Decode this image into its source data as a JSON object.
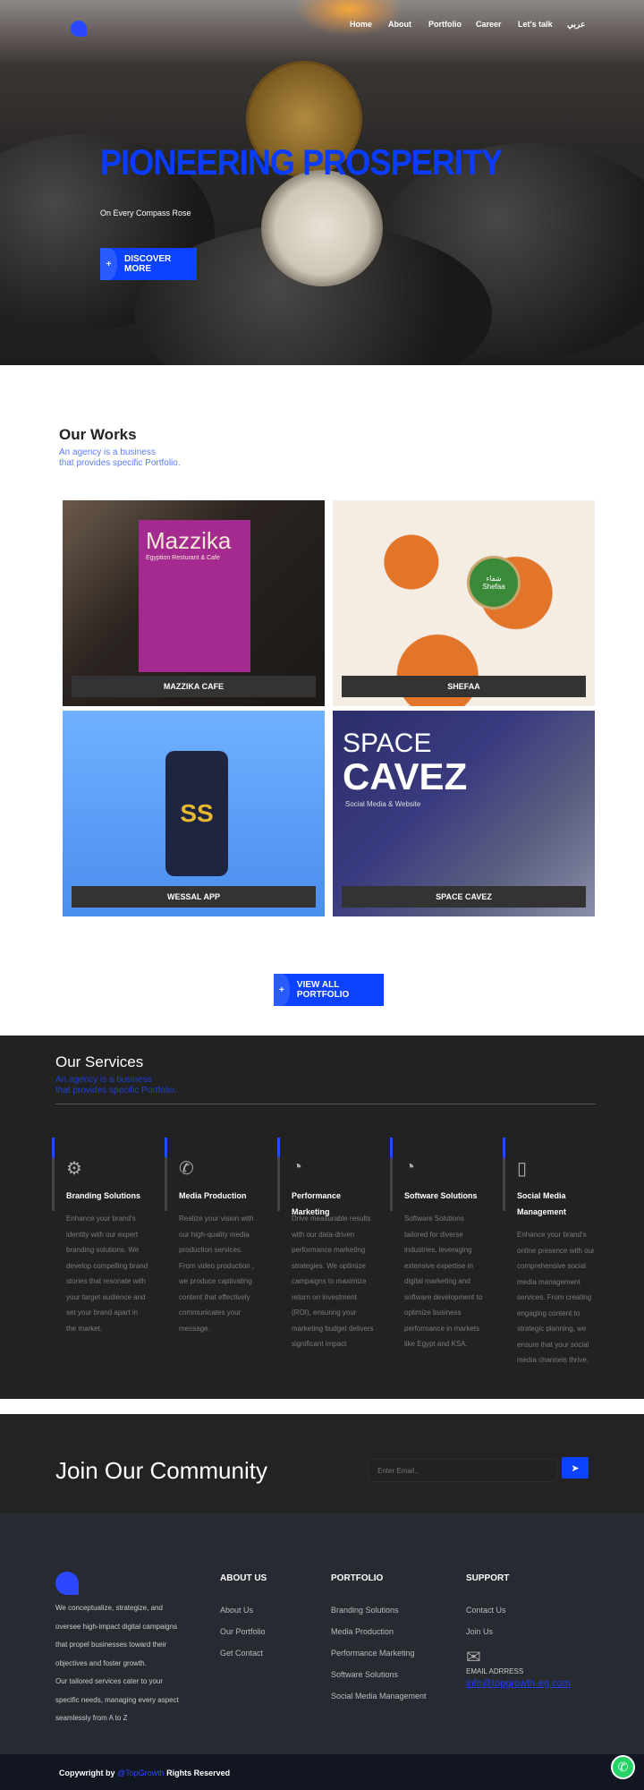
{
  "nav": {
    "items": [
      "Home",
      "About",
      "Portfolio",
      "Career",
      "Let's talk",
      "عربي"
    ]
  },
  "hero": {
    "title": "PIONEERING PROSPERITY",
    "subtitle": "On Every Compass Rose",
    "button": "DISCOVER MORE",
    "button_icon": "+"
  },
  "works": {
    "title": "Our Works",
    "subtitle_line1": "An agency is a business",
    "subtitle_line2": "that provides specific Portfolio.",
    "cards": [
      {
        "label": "MAZZIKA CAFE",
        "art_title": "Mazzika",
        "art_sub": "Egyption Resturant & Cafe"
      },
      {
        "label": "SHEFAA",
        "art_title": "شفاء Shefaa"
      },
      {
        "label": "WESSAL APP",
        "art_title": "SS"
      },
      {
        "label": "SPACE CAVEZ",
        "art_title": "SPACE",
        "art_title2": "CAVEZ",
        "art_sub": "Social Media & Website"
      }
    ],
    "view_all": "VIEW ALL PORTFOLIO"
  },
  "services": {
    "title": "Our Services",
    "subtitle_line1": "An agency is a business",
    "subtitle_line2": "that provides specific Portfolio.",
    "items": [
      {
        "title": "Branding Solutions",
        "icon": "branding-icon",
        "desc": "Enhance your brand's identity with our expert branding solutions. We develop compelling brand stories that resonate with your target audience and set your brand apart in the market."
      },
      {
        "title": "Media Production",
        "icon": "phone-icon",
        "desc": "Realize your vision with our high-quality media production services. From video production , we produce captivating content that effectively communicates your message."
      },
      {
        "title": "Performance Marketing",
        "icon": "pie-chart-icon",
        "desc": "Drive measurable results with our data-driven performance marketing strategies. We optimize campaigns to maximize return on investment (ROI), ensuring your marketing budget delivers significant impact"
      },
      {
        "title": "Software Solutions",
        "icon": "pie-chart-icon",
        "desc": "Software Solutions tailored for diverse industries, leveraging extensive expertise in digital marketing and software development to optimize business performance in markets like Egypt and KSA."
      },
      {
        "title": "Social Media Management",
        "icon": "mobile-icon",
        "desc": "Enhance your brand's online presence with our comprehensive social media management services. From creating engaging content to strategic planning, we ensure that your social media channels thrive."
      }
    ]
  },
  "join": {
    "title": "Join Our Community",
    "placeholder": "Enter Email..",
    "send_icon": "paper-plane-icon"
  },
  "footer": {
    "about_text_1": "We conceptualize, strategize, and oversee high-impact digital campaigns that propel businesses toward their objectives and foster growth.",
    "about_text_2": "Our tailored services cater to your specific needs, managing every aspect seamlessly from A to Z",
    "columns": [
      {
        "heading": "ABOUT US",
        "links": [
          "About Us",
          "Our Portfolio",
          "Get Contact"
        ]
      },
      {
        "heading": "PORTFOLIO",
        "links": [
          "Branding Solutions",
          "Media Production",
          "Performance Marketing",
          "Software Solutions",
          "Social Media Management"
        ]
      },
      {
        "heading": "SUPPORT",
        "links": [
          "Contact Us",
          "Join Us"
        ]
      }
    ],
    "email_label": "EMAIL ADRRESS",
    "email": "info@topgrowth-eg.com"
  },
  "bottom": {
    "prefix": "Copywright by ",
    "brand": "@TopGrowth",
    "suffix": " Rights Reserved"
  },
  "colors": {
    "accent": "#0c41ff",
    "dark": "#222222",
    "footer": "#272a31",
    "whatsapp": "#25d366"
  }
}
